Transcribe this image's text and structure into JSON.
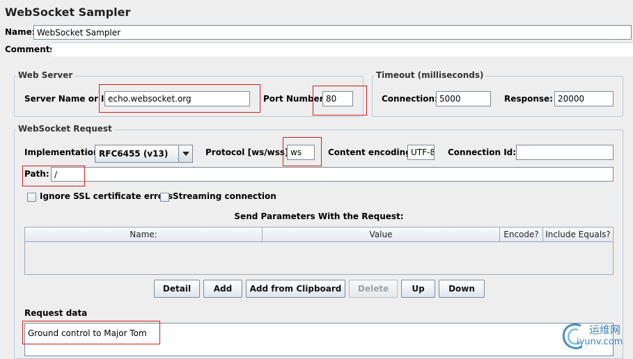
{
  "panel": {
    "title": "WebSocket Sampler"
  },
  "name_field": {
    "label": "Name:",
    "value": "WebSocket Sampler"
  },
  "comments": {
    "label": "Comments:",
    "value": ""
  },
  "web_server": {
    "legend": "Web Server",
    "server_label": "Server Name or IP:",
    "server_value": "echo.websocket.org",
    "port_label": "Port Number:",
    "port_value": "80"
  },
  "timeout": {
    "legend": "Timeout (milliseconds)",
    "connection_label": "Connection:",
    "connection_value": "5000",
    "response_label": "Response:",
    "response_value": "20000"
  },
  "ws_request": {
    "legend": "WebSocket Request",
    "implementation_label": "Implementation:",
    "implementation_value": "RFC6455 (v13)",
    "protocol_label": "Protocol [ws/wss]:",
    "protocol_value": "ws",
    "encoding_label": "Content encoding:",
    "encoding_value": "UTF-8",
    "connection_id_label": "Connection Id:",
    "connection_id_value": "",
    "path_label": "Path:",
    "path_value": "/",
    "ignore_ssl_label": "Ignore SSL certificate errors",
    "streaming_label": "Streaming connection"
  },
  "params": {
    "heading": "Send Parameters With the Request:",
    "columns": [
      "Name:",
      "Value",
      "Encode?",
      "Include Equals?"
    ]
  },
  "buttons": {
    "detail": "Detail",
    "add": "Add",
    "add_clipboard": "Add from Clipboard",
    "delete": "Delete",
    "up": "Up",
    "down": "Down"
  },
  "request_data": {
    "label": "Request data",
    "value": "Ground control to Major Tom"
  },
  "watermark": {
    "text": "运维网",
    "url_text": "iyunv.com"
  },
  "colors": {
    "highlight": "#cc1f1f",
    "background": "#eeeeee",
    "watermark": "#1b6fb3"
  }
}
